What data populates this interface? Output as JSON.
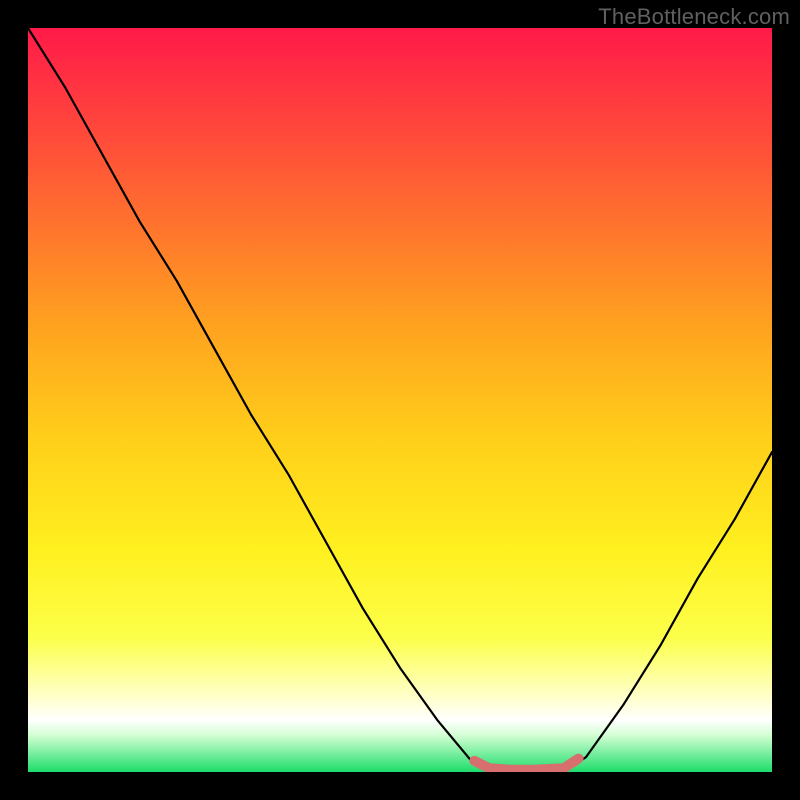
{
  "watermark": "TheBottleneck.com",
  "colors": {
    "frame": "#000000",
    "curve": "#000000",
    "accent": "#d86f6f",
    "gradient_top": "#ff1a49",
    "gradient_mid": "#ffd21f",
    "gradient_yellowwhite": "#ffffb3",
    "gradient_green": "#1ddd6a",
    "watermark": "#606060"
  },
  "chart_data": {
    "type": "line",
    "title": "",
    "xlabel": "",
    "ylabel": "",
    "xlim": [
      0,
      100
    ],
    "ylim": [
      0,
      100
    ],
    "series": [
      {
        "name": "bottleneck-curve",
        "x": [
          0,
          5,
          10,
          15,
          20,
          25,
          30,
          35,
          40,
          45,
          50,
          55,
          60,
          62,
          65,
          68,
          72,
          75,
          80,
          85,
          90,
          95,
          100
        ],
        "y": [
          100,
          92,
          83,
          74,
          66,
          57,
          48,
          40,
          31,
          22,
          14,
          7,
          1,
          0,
          0,
          0,
          0,
          2,
          9,
          17,
          26,
          34,
          43
        ]
      },
      {
        "name": "sweet-spot-segment",
        "x": [
          60,
          62,
          65,
          68,
          72,
          74
        ],
        "y": [
          1.5,
          0.5,
          0.3,
          0.3,
          0.5,
          1.8
        ]
      }
    ],
    "annotations": []
  }
}
